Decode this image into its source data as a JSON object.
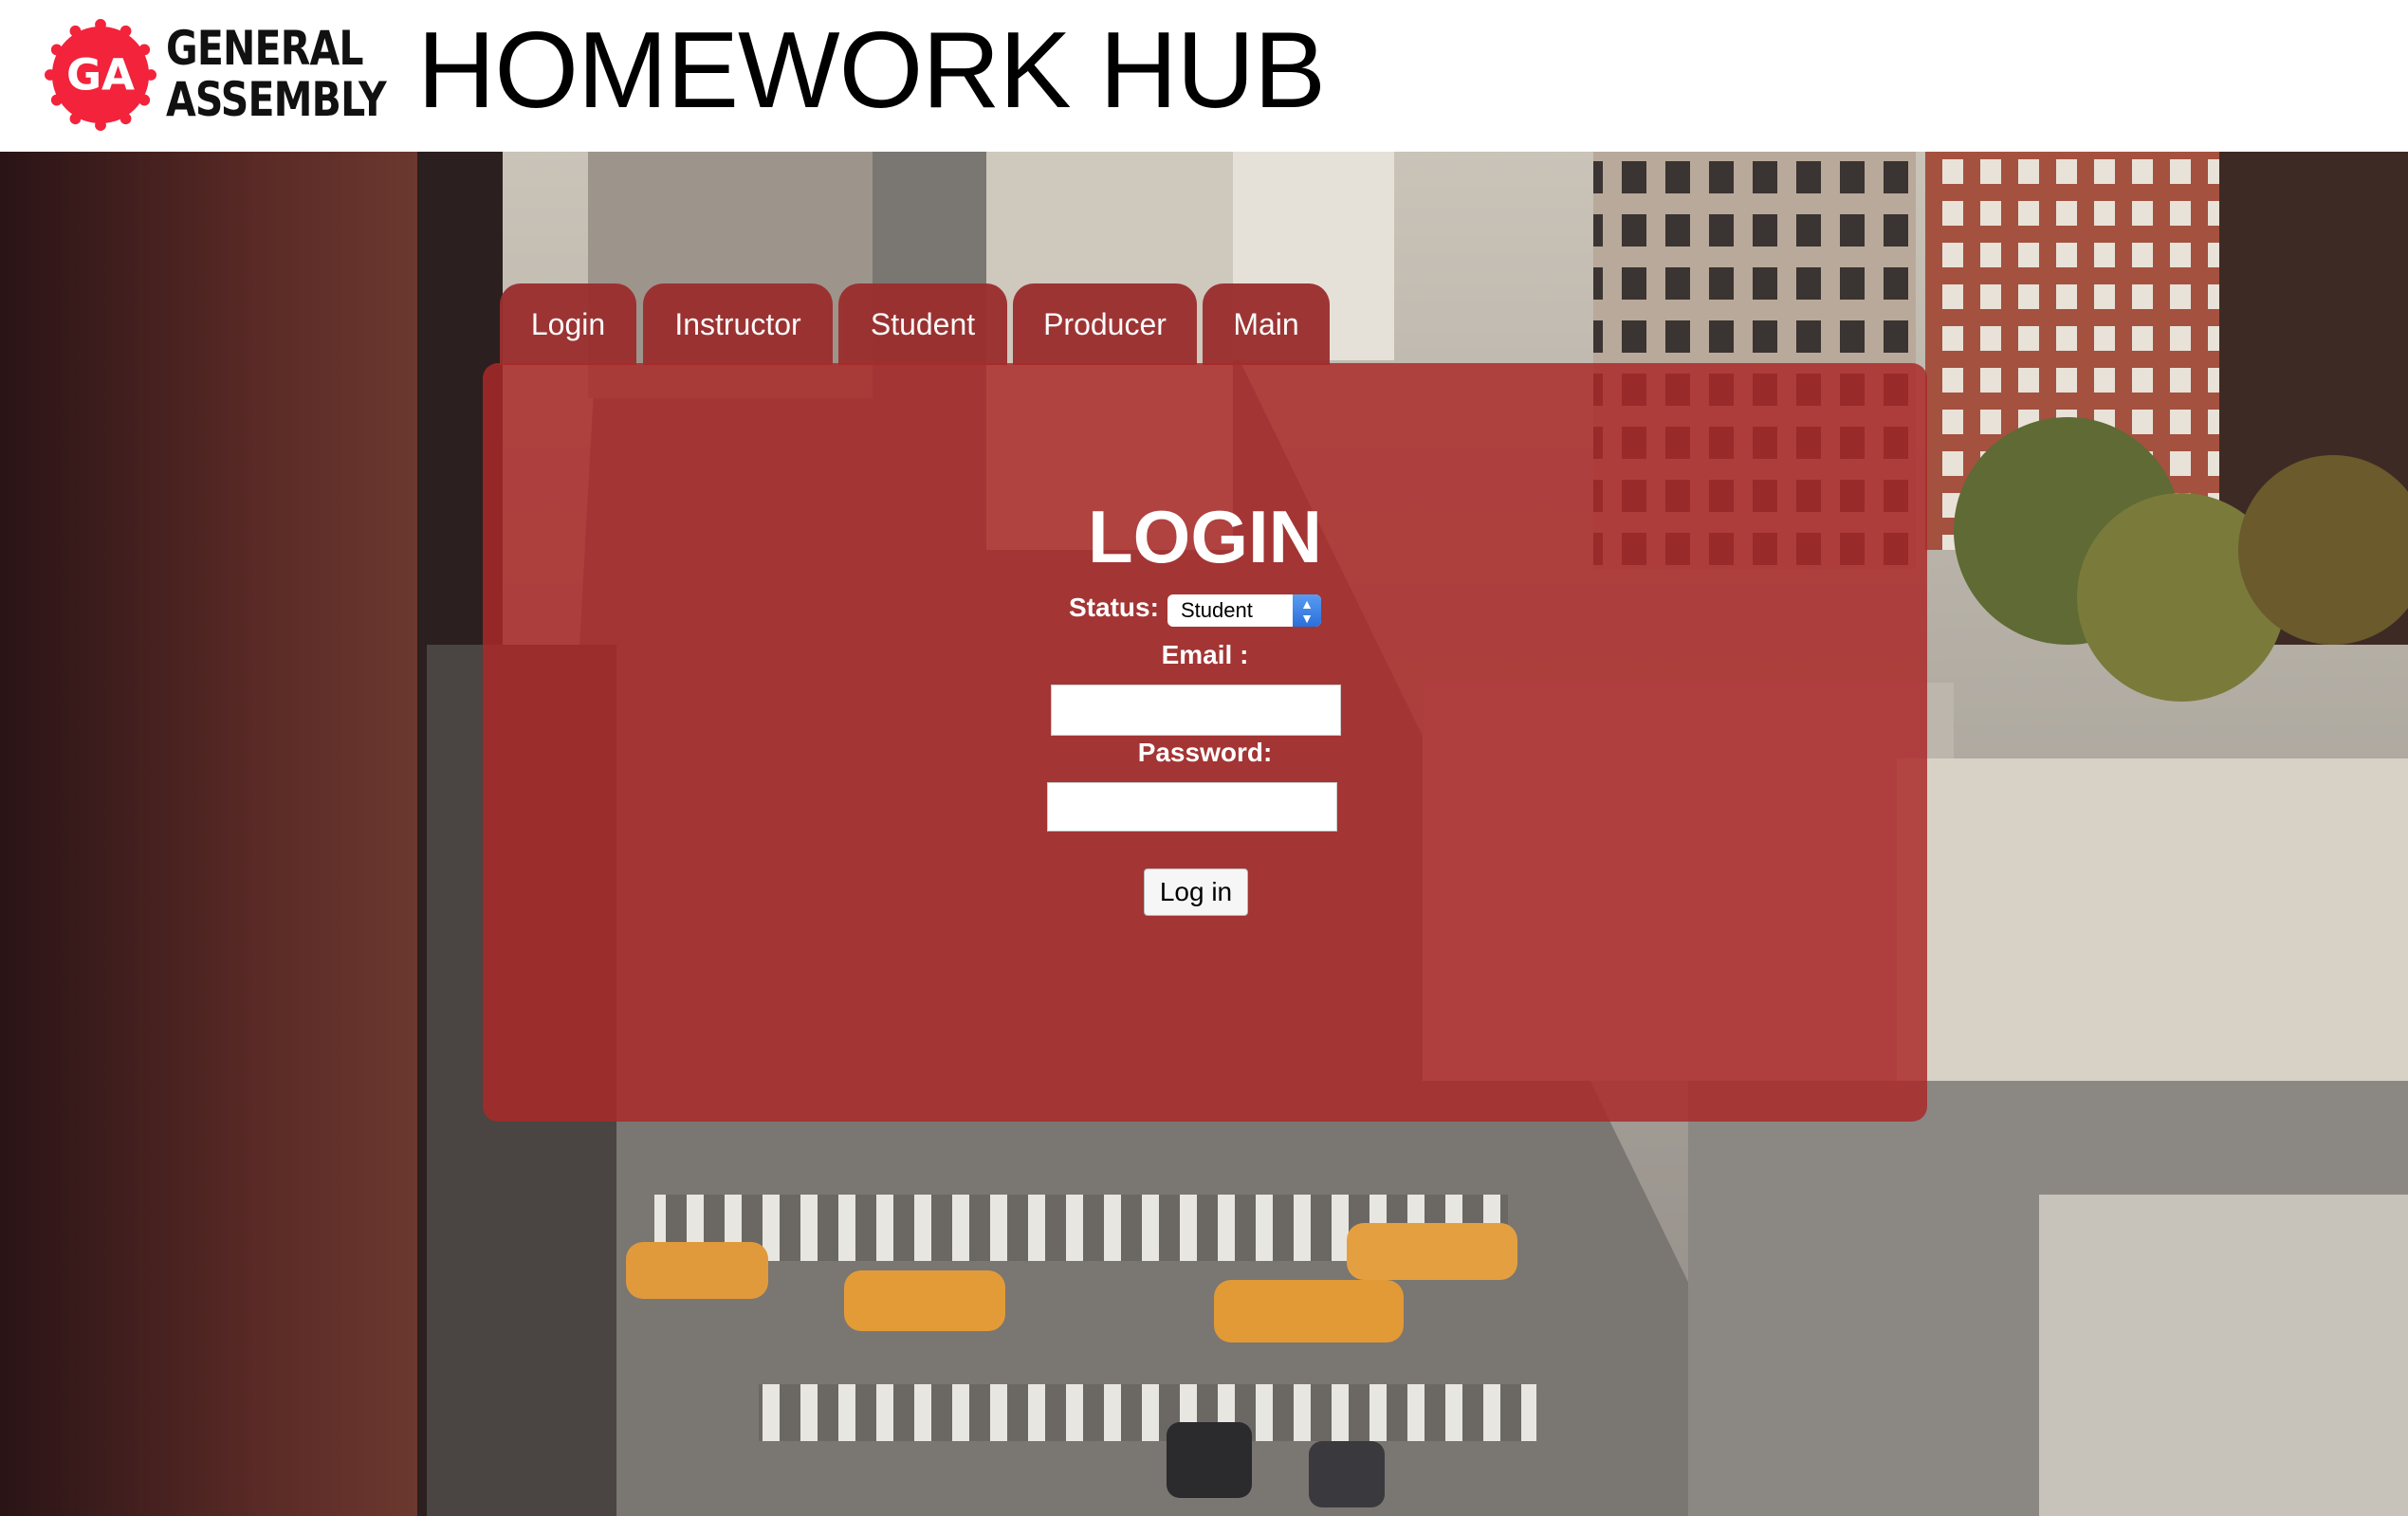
{
  "header": {
    "logo_mark": "GA",
    "logo_line1": "GENERAL",
    "logo_line2": "ASSEMBLY",
    "title": "HOMEWORK HUB",
    "brand_color": "#f2233b"
  },
  "tabs": [
    {
      "label": "Login"
    },
    {
      "label": "Instructor"
    },
    {
      "label": "Student"
    },
    {
      "label": "Producer"
    },
    {
      "label": "Main"
    }
  ],
  "login_form": {
    "heading": "LOGIN",
    "status_label": "Status:",
    "status_value": "Student",
    "email_label": "Email :",
    "email_value": "",
    "password_label": "Password:",
    "password_value": "",
    "submit_label": "Log in"
  },
  "colors": {
    "panel": "#aa2828",
    "tab": "#9b2f2f"
  }
}
